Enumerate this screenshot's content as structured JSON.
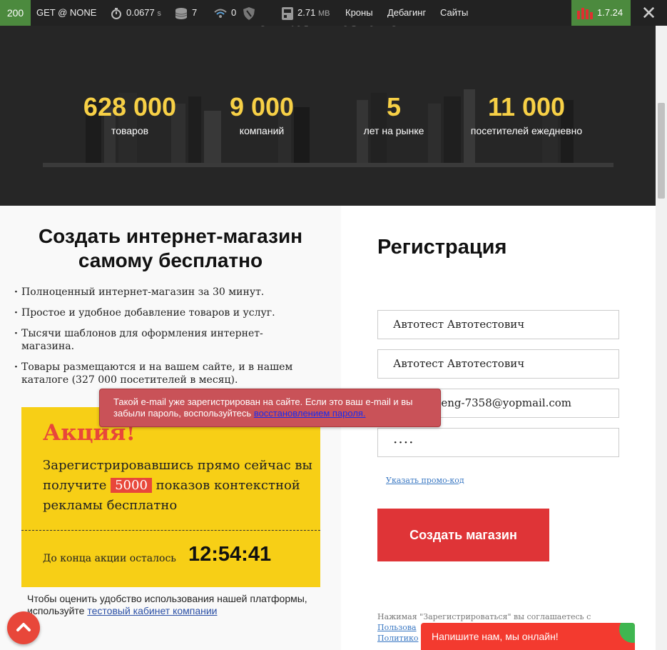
{
  "toolbar": {
    "status_code": "200",
    "request": "GET @ NONE",
    "time_value": "0.0677",
    "time_unit": "s",
    "db_queries": "7",
    "events": "0",
    "memory_value": "2.71",
    "memory_unit": "MB",
    "menu": [
      "Кроны",
      "Дебагинг",
      "Сайты"
    ],
    "version": "1.7.24"
  },
  "hero": {
    "title_fragment": "romaskz.ts  это:",
    "stats": [
      {
        "value": "628 000",
        "label": "товаров"
      },
      {
        "value": "9 000",
        "label": "компаний"
      },
      {
        "value": "5",
        "label": "лет на рынке"
      },
      {
        "value": "11 000",
        "label": "посетителей ежедневно"
      }
    ]
  },
  "left": {
    "heading": "Создать интернет-магазин самому бесплатно",
    "features": [
      "Полноценный интернет-магазин за 30 минут.",
      "Простое и удобное добавление товаров и услуг.",
      "Тысячи шаблонов для оформления интернет-магазина.",
      "Товары размещаются и на вашем сайте, и в нашем каталоге (327 000 посетителей в месяц)."
    ],
    "promo": {
      "title": "Акция!",
      "text_before": "Зарегистрировавшись прямо сейчас вы получите",
      "highlight": "5000",
      "text_after": "показов контекстной рекламы бесплатно",
      "countdown_label": "До конца акции осталось",
      "countdown": "12:54:41"
    },
    "demo_note_text": "Чтобы оценить удобство использования нашей платформы, используйте",
    "demo_note_link": "тестовый кабинет компании"
  },
  "registration": {
    "heading": "Регистрация",
    "fields": [
      {
        "name": "first-name",
        "value": "Автотест Автотестович"
      },
      {
        "name": "company-name",
        "value": "Автотест Автотестович"
      },
      {
        "name": "email",
        "value": "autotest-eng-7358@yopmail.com"
      },
      {
        "name": "password",
        "value": "····"
      }
    ],
    "promo_link": "Указать промо-код",
    "submit_label": "Создать магазин",
    "legal_text": "Нажимая \"Зарегистрироваться\" вы соглашаетесь с",
    "legal_link_1": "Пользова",
    "legal_link_2": "Политико"
  },
  "error": {
    "text": "Такой e-mail уже зарегистрирован на сайте. Если это ваш e-mail и вы забыли пароль, воспользуйтесь",
    "link": "восстановлением пароля."
  },
  "chat": {
    "label": "Напишите нам, мы онлайн!"
  },
  "colors": {
    "accent_red": "#df3437",
    "promo_yellow": "#f7cf16",
    "stat_yellow": "#f7d046",
    "status_green": "#4c8a3e"
  }
}
